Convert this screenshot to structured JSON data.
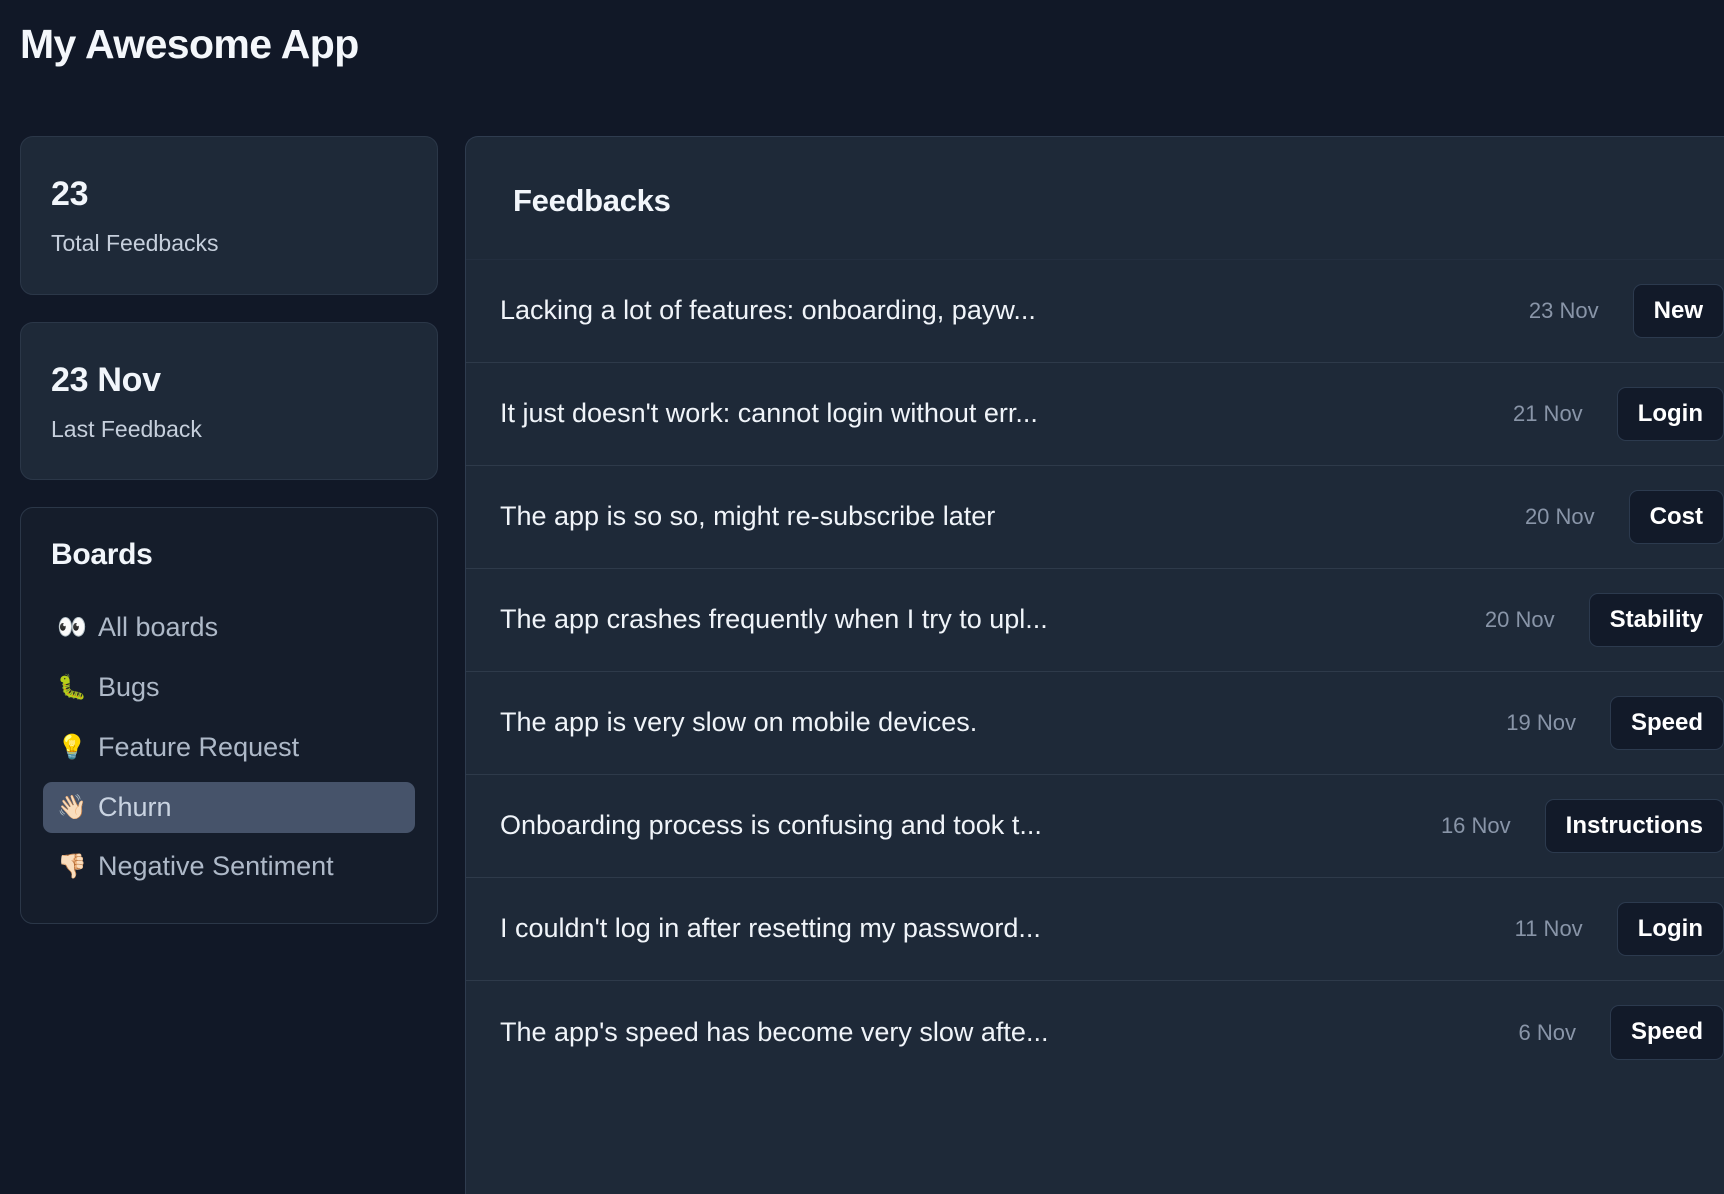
{
  "app": {
    "title": "My Awesome App",
    "colors": {
      "page_bg": "#111827",
      "card_bg": "#1e2938",
      "panel_bg": "#1e2938",
      "selected_bg": "#46536a",
      "tag_bg": "#121a29",
      "muted_text": "#8995a8"
    }
  },
  "sidebar": {
    "stats": [
      {
        "value": "23",
        "label": "Total Feedbacks"
      },
      {
        "value": "23 Nov",
        "label": "Last Feedback"
      }
    ],
    "boards": {
      "title": "Boards",
      "items": [
        {
          "emoji": "👀",
          "icon_name": "eyes-icon",
          "label": "All boards",
          "selected": false
        },
        {
          "emoji": "🐛",
          "icon_name": "bug-icon",
          "label": "Bugs",
          "selected": false
        },
        {
          "emoji": "💡",
          "icon_name": "lightbulb-icon",
          "label": "Feature Request",
          "selected": false
        },
        {
          "emoji": "👋🏻",
          "icon_name": "waving-hand-icon",
          "label": "Churn",
          "selected": true
        },
        {
          "emoji": "👎🏻",
          "icon_name": "thumbs-down-icon",
          "label": "Negative Sentiment",
          "selected": false
        }
      ]
    }
  },
  "main": {
    "title": "Feedbacks",
    "feedbacks": [
      {
        "text": "Lacking a lot of features: onboarding, payw...",
        "date": "23 Nov",
        "tag": "New"
      },
      {
        "text": "It just doesn't work: cannot login without err...",
        "date": "21 Nov",
        "tag": "Login"
      },
      {
        "text": "The app is so so, might re-subscribe later",
        "date": "20 Nov",
        "tag": "Cost"
      },
      {
        "text": "The app crashes frequently when I try to upl...",
        "date": "20 Nov",
        "tag": "Stability"
      },
      {
        "text": "The app is very slow on mobile devices.",
        "date": "19 Nov",
        "tag": "Speed"
      },
      {
        "text": "Onboarding process is confusing and took t...",
        "date": "16 Nov",
        "tag": "Instructions"
      },
      {
        "text": "I couldn't log in after resetting my password...",
        "date": "11 Nov",
        "tag": "Login"
      },
      {
        "text": "The app's speed has become very slow afte...",
        "date": "6 Nov",
        "tag": "Speed"
      }
    ]
  }
}
